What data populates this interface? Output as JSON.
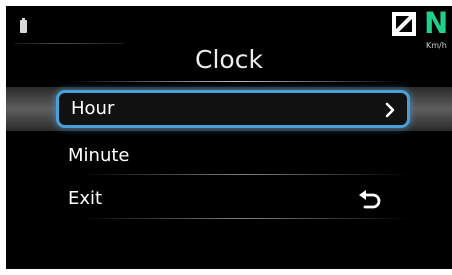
{
  "status_bar": {
    "battery_icon": "battery-icon",
    "gear_box_icon": "gear-box-icon",
    "gear": "N",
    "speed_unit": "Km/h"
  },
  "screen": {
    "title": "Clock"
  },
  "menu": {
    "items": [
      {
        "label": "Hour",
        "icon": "chevron-right-icon",
        "selected": true
      },
      {
        "label": "Minute",
        "icon": null,
        "selected": false
      },
      {
        "label": "Exit",
        "icon": "back-arrow-icon",
        "selected": false
      }
    ]
  },
  "colors": {
    "background": "#000000",
    "selection_border": "#4aa0d6",
    "gear_indicator": "#1fd08b",
    "text": "#ffffff"
  }
}
